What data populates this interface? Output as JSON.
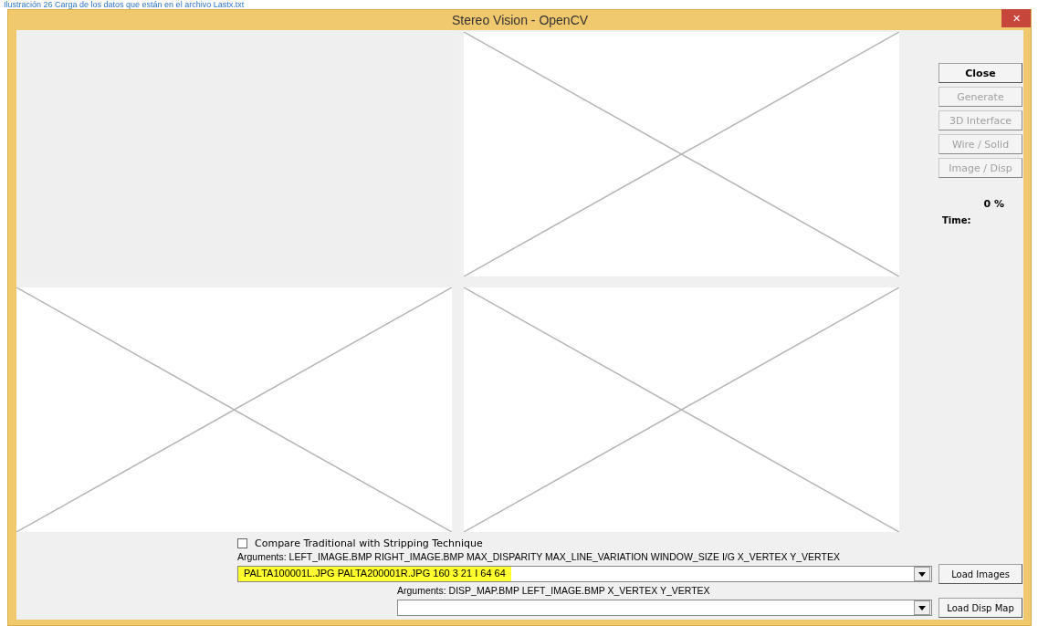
{
  "caption": "Ilustración 26 Carga de los datos que están en el archivo Lastx.txt",
  "window": {
    "title": "Stereo Vision - OpenCV",
    "close_glyph": "✕"
  },
  "panes": [
    {
      "kind": "empty"
    },
    {
      "kind": "placeholder"
    },
    {
      "kind": "placeholder"
    },
    {
      "kind": "placeholder"
    }
  ],
  "buttons": [
    {
      "label": "Close",
      "disabled": false
    },
    {
      "label": "Generate",
      "disabled": true
    },
    {
      "label": "3D Interface",
      "disabled": true
    },
    {
      "label": "Wire / Solid",
      "disabled": true
    },
    {
      "label": "Image / Disp",
      "disabled": true
    }
  ],
  "progress": "0 %",
  "time_label": "Time:",
  "compare": {
    "label": "Compare Traditional with Stripping Technique",
    "checked": false
  },
  "images_args": {
    "label": "Arguments: LEFT_IMAGE.BMP RIGHT_IMAGE.BMP MAX_DISPARITY MAX_LINE_VARIATION WINDOW_SIZE I/G X_VERTEX Y_VERTEX",
    "value": "PALTA100001L.JPG PALTA200001R.JPG 160 3 21 I 64 64",
    "highlighted": true,
    "button": "Load Images"
  },
  "disp_args": {
    "label": "Arguments: DISP_MAP.BMP LEFT_IMAGE.BMP X_VERTEX Y_VERTEX",
    "button": "Load Disp Map"
  }
}
